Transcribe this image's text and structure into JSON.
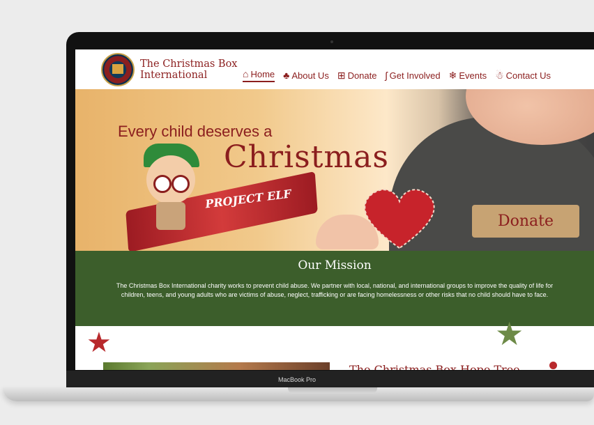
{
  "site": {
    "name_line1": "The Christmas Box",
    "name_line2": "International"
  },
  "nav": [
    {
      "label": "Home",
      "icon": "house-icon",
      "glyph": "⌂"
    },
    {
      "label": "About Us",
      "icon": "tree-icon",
      "glyph": "♣"
    },
    {
      "label": "Donate",
      "icon": "gift-icon",
      "glyph": "⊞"
    },
    {
      "label": "Get Involved",
      "icon": "candy-cane-icon",
      "glyph": "ʃ"
    },
    {
      "label": "Events",
      "icon": "snowflake-icon",
      "glyph": "❄"
    },
    {
      "label": "Contact Us",
      "icon": "gingerbread-icon",
      "glyph": "☃"
    }
  ],
  "hero": {
    "tagline": "Every child deserves a",
    "headline": "Christmas",
    "ribbon": "PROJECT ELF",
    "donate_label": "Donate"
  },
  "mission": {
    "title": "Our Mission",
    "text": "The Christmas Box International charity works to prevent child abuse. We partner with local, national, and international groups to improve the quality of life for children, teens, and young adults who are victims of abuse, neglect, trafficking or are facing homelessness or other risks that no child should have to face."
  },
  "lower": {
    "heading": "The Christmas Box Hope Tree"
  },
  "device": {
    "label": "MacBook Pro"
  },
  "colors": {
    "brand_red": "#8b1e1e",
    "mission_green": "#3c5e2b",
    "donate_tan": "#c7a373"
  }
}
